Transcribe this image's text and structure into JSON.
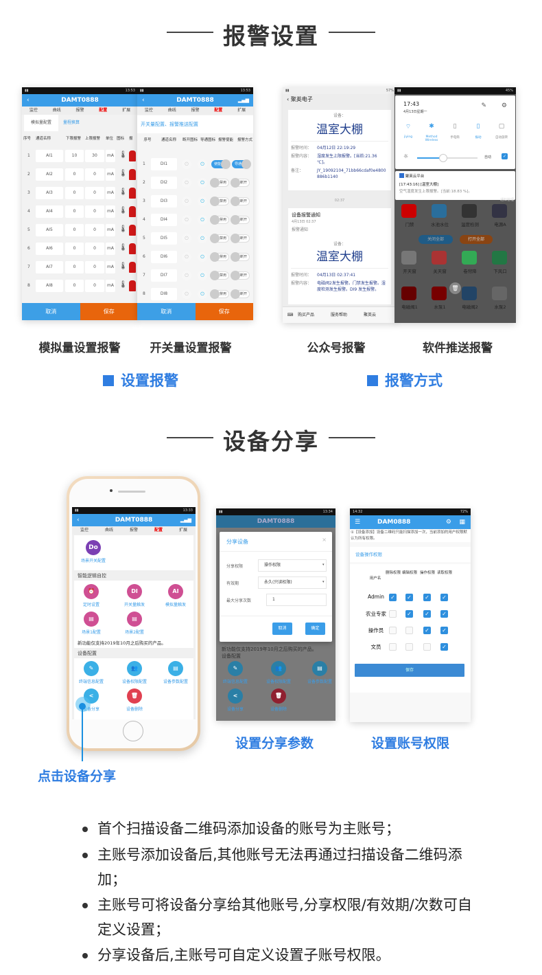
{
  "section1": {
    "title": "报警设置"
  },
  "analog": {
    "device": "DAMT0888",
    "nav_tabs": [
      "监控",
      "曲线",
      "报警",
      "配置",
      "扩展"
    ],
    "active_tab": "配置",
    "subtabs": [
      "模拟量配置",
      "量程换算"
    ],
    "columns": [
      "序号",
      "通道名称",
      "下限报警",
      "上限报警",
      "单位",
      "图标",
      "报"
    ],
    "rows": [
      [
        "1",
        "AI1",
        "10",
        "30",
        "mA"
      ],
      [
        "2",
        "AI2",
        "0",
        "0",
        "mA"
      ],
      [
        "3",
        "AI3",
        "0",
        "0",
        "mA"
      ],
      [
        "4",
        "AI4",
        "0",
        "0",
        "mA"
      ],
      [
        "5",
        "AI5",
        "0",
        "0",
        "mA"
      ],
      [
        "6",
        "AI6",
        "0",
        "0",
        "mA"
      ],
      [
        "7",
        "AI7",
        "0",
        "0",
        "mA"
      ],
      [
        "8",
        "AI8",
        "0",
        "0",
        "mA"
      ]
    ],
    "cancel": "取消",
    "save": "保存"
  },
  "digital": {
    "device": "DAMT0888",
    "heading": "开关量配置、报警推送配置",
    "columns": [
      "序号",
      "通道名称",
      "断开图标",
      "导通图标",
      "报警使能",
      "报警方式"
    ],
    "rows": [
      {
        "no": "1",
        "name": "DI1",
        "enable": "使能",
        "enable_on": true,
        "mode": "导通",
        "mode_on": true
      },
      {
        "no": "2",
        "name": "DI2",
        "enable": "禁用",
        "enable_on": false,
        "mode": "断开",
        "mode_on": false
      },
      {
        "no": "3",
        "name": "DI3",
        "enable": "禁用",
        "enable_on": false,
        "mode": "断开",
        "mode_on": false
      },
      {
        "no": "4",
        "name": "DI4",
        "enable": "禁用",
        "enable_on": false,
        "mode": "断开",
        "mode_on": false
      },
      {
        "no": "5",
        "name": "DI5",
        "enable": "禁用",
        "enable_on": false,
        "mode": "断开",
        "mode_on": false
      },
      {
        "no": "6",
        "name": "DI6",
        "enable": "禁用",
        "enable_on": false,
        "mode": "断开",
        "mode_on": false
      },
      {
        "no": "7",
        "name": "DI7",
        "enable": "禁用",
        "enable_on": false,
        "mode": "断开",
        "mode_on": false
      },
      {
        "no": "8",
        "name": "DI8",
        "enable": "禁用",
        "enable_on": false,
        "mode": "断开",
        "mode_on": false
      }
    ],
    "cancel": "取消",
    "save": "保存"
  },
  "wechat": {
    "account": "聚英电子",
    "device_label": "设备：",
    "msg1": {
      "device": "温室大棚",
      "time_label": "报警时间：",
      "time": "04月12日 22:19:29",
      "content_label": "报警内容：",
      "content": "湿度发生上限报警。[当前:21.36 ℃]。",
      "note_label": "备注：",
      "note": "JY_19092104_71bb66cdaf0e4800886b1140"
    },
    "divider_time": "02:37",
    "msg2": {
      "title": "设备报警通知",
      "date": "4月13日 02:37",
      "sub": "报警通知",
      "device": "温室大棚",
      "time_label": "报警时间：",
      "time": "04月13日 02:37:41",
      "content_label": "报警内容：",
      "content": "电磁阀2发生报警。门禁发生报警。湿度检测发生报警。DI9 发生报警。"
    },
    "menu": [
      "购买产品",
      "服务帮助",
      "聚英云"
    ]
  },
  "push": {
    "clock": "17:43",
    "date": "4月13日星期一",
    "toggles": [
      "jiying",
      "Method Wireless",
      "手电筒",
      "振动",
      "自动旋转"
    ],
    "auto_label": "自动",
    "app": "聚英云平台",
    "notif_title": "[17:43:16] [温室大棚]",
    "notif_body": "空气湿度发生上限报警。[当前:18.83 %]。",
    "tiles": [
      "门禁",
      "水池水位",
      "温度检测",
      "电源A"
    ],
    "btn_off": "关闭全部",
    "btn_on": "打开全部",
    "tiles2": [
      "开天窗",
      "关天窗",
      "卷帘降",
      "下风口"
    ],
    "tiles3": [
      "电磁阀1",
      "水泵1",
      "电磁阀2",
      "水泵2"
    ],
    "notice_tag": "通知管理"
  },
  "captions": [
    "模拟量设置报警",
    "开关量设置报警",
    "公众号报警",
    "软件推送报警"
  ],
  "groups": [
    "设置报警",
    "报警方式"
  ],
  "section2": {
    "title": "设备分享"
  },
  "config_phone": {
    "device": "DAMT0888",
    "scene_switch": "场景开关配置",
    "logic_header": "智能逻辑自控",
    "logic_items": [
      {
        "icon": "⏰",
        "label": "定时设置"
      },
      {
        "icon": "DI",
        "label": "开关量触发"
      },
      {
        "icon": "AI",
        "label": "模拟量触发"
      },
      {
        "icon": "▤",
        "label": "场景1配置"
      },
      {
        "icon": "▤",
        "label": "场景2配置"
      }
    ],
    "notice": "新功能仅支持2019年10月之后购买的产品。",
    "device_header": "设备配置",
    "device_items": [
      {
        "icon": "✎",
        "label": "终端信息配置"
      },
      {
        "icon": "👥",
        "label": "设备权限配置"
      },
      {
        "icon": "▤",
        "label": "设备参数配置"
      },
      {
        "icon": "<",
        "label": "设备分享"
      },
      {
        "icon": "🗑",
        "label": "设备删除"
      }
    ]
  },
  "share_dialog": {
    "title": "分享设备",
    "fields": [
      {
        "label": "分享权限",
        "value": "操作权限"
      },
      {
        "label": "有效期",
        "value": "永久(只读权限)"
      },
      {
        "label": "最大分享次数",
        "value": "1"
      }
    ],
    "cancel": "取消",
    "ok": "确定"
  },
  "perm": {
    "device": "DAM0888",
    "tip": "①【设备添加】设备二维码只能扫描添加一次，当前添加的用户权限默认为所有权限。",
    "section": "设备操作权限",
    "columns": [
      "用户名",
      "删除权限",
      "编辑权限",
      "操作权限",
      "读取权限"
    ],
    "rows": [
      {
        "user": "Admin",
        "perms": [
          true,
          true,
          true,
          true
        ]
      },
      {
        "user": "农业专家",
        "perms": [
          false,
          true,
          true,
          true
        ]
      },
      {
        "user": "操作员",
        "perms": [
          false,
          false,
          true,
          true
        ]
      },
      {
        "user": "文员",
        "perms": [
          false,
          false,
          false,
          true
        ]
      }
    ],
    "save": "保存"
  },
  "captions2": [
    "设置分享参数",
    "设置账号权限"
  ],
  "tap_hint": "点击设备分享",
  "bullets": [
    "首个扫描设备二维码添加设备的账号为主账号；",
    "主账号添加设备后,其他账号无法再通过扫描设备二维码添加；",
    "主账号可将设备分享给其他账号,分享权限/有效期/次数可自定义设置；",
    "分享设备后,主账号可自定义设置子账号权限。"
  ],
  "colors": {
    "accent": "#2f7de1",
    "app_blue": "#3a9de8",
    "save_orange": "#e8650c"
  }
}
